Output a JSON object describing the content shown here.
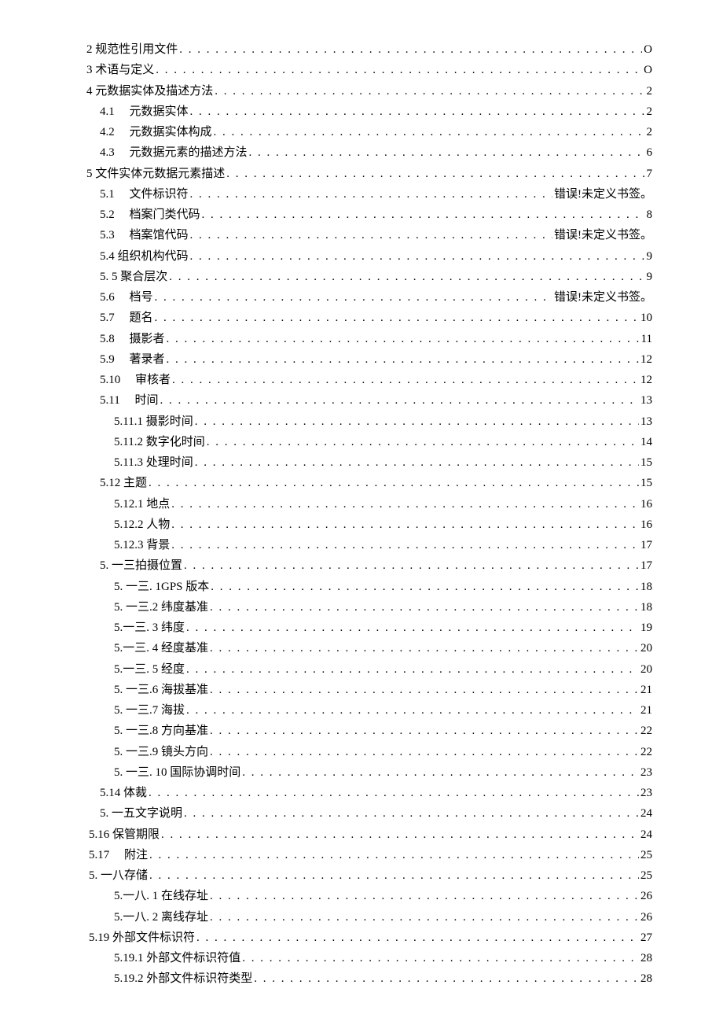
{
  "toc": [
    {
      "indent": "l0",
      "label": "2 规范性引用文件",
      "page": "O"
    },
    {
      "indent": "l0",
      "label": "3 术语与定义",
      "page": "O"
    },
    {
      "indent": "l0",
      "label": "4 元数据实体及描述方法",
      "page": "2"
    },
    {
      "indent": "l1",
      "label": "4.1  元数据实体",
      "page": "2"
    },
    {
      "indent": "l1",
      "label": "4.2  元数据实体构成",
      "page": "2"
    },
    {
      "indent": "l1",
      "label": "4.3  元数据元素的描述方法",
      "page": "6"
    },
    {
      "indent": "l0",
      "label": "5 文件实体元数据元素描述",
      "page": "7"
    },
    {
      "indent": "l1",
      "label": "5.1  文件标识符",
      "page": "错误!未定义书签。"
    },
    {
      "indent": "l1",
      "label": "5.2  档案门类代码",
      "page": "8"
    },
    {
      "indent": "l1",
      "label": "5.3  档案馆代码",
      "page": "错误!未定义书签。"
    },
    {
      "indent": "l1",
      "label": "5.4 组织机构代码",
      "page": "9"
    },
    {
      "indent": "l1",
      "label": "5.   5 聚合层次",
      "page": "9"
    },
    {
      "indent": "l1",
      "label": "5.6  档号",
      "page": "错误!未定义书签。"
    },
    {
      "indent": "l1",
      "label": "5.7  题名",
      "page": "10"
    },
    {
      "indent": "l1",
      "label": "5.8  摄影者",
      "page": "11"
    },
    {
      "indent": "l1",
      "label": "5.9  著录者",
      "page": "12"
    },
    {
      "indent": "l1",
      "label": "5.10   审核者",
      "page": "12"
    },
    {
      "indent": "l1",
      "label": "5.11  时间",
      "page": "13"
    },
    {
      "indent": "l2",
      "label": "5.11.1 摄影时间",
      "page": "13"
    },
    {
      "indent": "l2",
      "label": "5.11.2 数字化时间",
      "page": "14"
    },
    {
      "indent": "l2",
      "label": "5.11.3 处理时间",
      "page": "15"
    },
    {
      "indent": "l1",
      "label": "5.12 主题",
      "page": "15"
    },
    {
      "indent": "l2",
      "label": "5.12.1 地点",
      "page": "16"
    },
    {
      "indent": "l2",
      "label": "5.12.2 人物",
      "page": "16"
    },
    {
      "indent": "l2",
      "label": "5.12.3 背景",
      "page": "17"
    },
    {
      "indent": "l1",
      "label": "5. 一三拍摄位置",
      "page": "17"
    },
    {
      "indent": "l2",
      "label": "5. 一三. 1GPS 版本",
      "page": "18"
    },
    {
      "indent": "l2",
      "label": "5. 一三.2 纬度基准",
      "page": "18"
    },
    {
      "indent": "l2",
      "label": "5.一三. 3 纬度",
      "page": "19"
    },
    {
      "indent": "l2",
      "label": "5.一三. 4 经度基准",
      "page": "20"
    },
    {
      "indent": "l2",
      "label": "5.一三. 5 经度",
      "page": "20"
    },
    {
      "indent": "l2",
      "label": "5. 一三.6 海拔基准",
      "page": "21"
    },
    {
      "indent": "l2",
      "label": "5. 一三.7 海拔",
      "page": "21"
    },
    {
      "indent": "l2",
      "label": "5. 一三.8 方向基准",
      "page": "22"
    },
    {
      "indent": "l2",
      "label": "5. 一三.9 镜头方向",
      "page": "22"
    },
    {
      "indent": "l2",
      "label": "5. 一三. 10 国际协调时间",
      "page": "23"
    },
    {
      "indent": "l1",
      "label": "5.14 体裁",
      "page": "23"
    },
    {
      "indent": "l1",
      "label": "5. 一五文字说明",
      "page": "24"
    },
    {
      "indent": "l1alt",
      "label": "5.16 保管期限",
      "page": "24"
    },
    {
      "indent": "l1alt",
      "label": "5.17  附注",
      "page": "25"
    },
    {
      "indent": "l1alt",
      "label": "5. 一八存储",
      "page": "25"
    },
    {
      "indent": "l2",
      "label": "5.一八. 1 在线存址",
      "page": "26"
    },
    {
      "indent": "l2",
      "label": "5.一八. 2 离线存址",
      "page": "26"
    },
    {
      "indent": "l1alt",
      "label": "5.19 外部文件标识符",
      "page": "27"
    },
    {
      "indent": "l2",
      "label": "5.19.1 外部文件标识符值",
      "page": "28"
    },
    {
      "indent": "l2",
      "label": "5.19.2 外部文件标识符类型",
      "page": "28"
    }
  ]
}
